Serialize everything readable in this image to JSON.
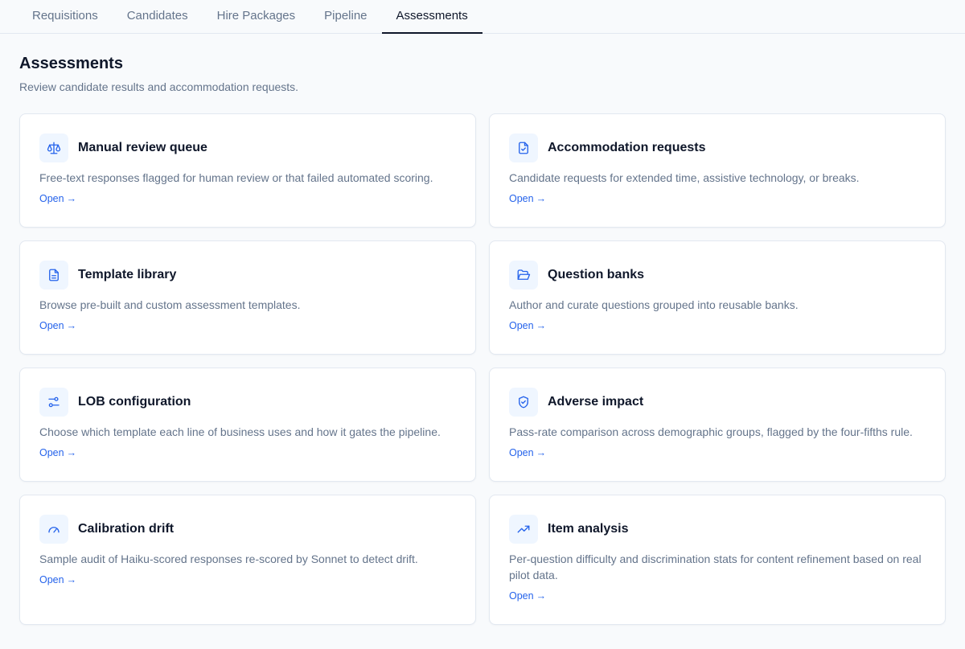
{
  "tabs": [
    {
      "label": "Requisitions"
    },
    {
      "label": "Candidates"
    },
    {
      "label": "Hire Packages"
    },
    {
      "label": "Pipeline"
    },
    {
      "label": "Assessments"
    }
  ],
  "active_tab": "Assessments",
  "page": {
    "title": "Assessments",
    "subtitle": "Review candidate results and accommodation requests."
  },
  "cards": [
    {
      "icon": "scale-icon",
      "title": "Manual review queue",
      "description": "Free-text responses flagged for human review or that failed automated scoring.",
      "link": "Open",
      "arrow": "→"
    },
    {
      "icon": "file-check-icon",
      "title": "Accommodation requests",
      "description": "Candidate requests for extended time, assistive technology, or breaks.",
      "link": "Open",
      "arrow": "→"
    },
    {
      "icon": "document-icon",
      "title": "Template library",
      "description": "Browse pre-built and custom assessment templates.",
      "link": "Open",
      "arrow": "→"
    },
    {
      "icon": "folder-open-icon",
      "title": "Question banks",
      "description": "Author and curate questions grouped into reusable banks.",
      "link": "Open",
      "arrow": "→"
    },
    {
      "icon": "sliders-icon",
      "title": "LOB configuration",
      "description": "Choose which template each line of business uses and how it gates the pipeline.",
      "link": "Open",
      "arrow": "→"
    },
    {
      "icon": "shield-check-icon",
      "title": "Adverse impact",
      "description": "Pass-rate comparison across demographic groups, flagged by the four-fifths rule.",
      "link": "Open",
      "arrow": "→"
    },
    {
      "icon": "gauge-icon",
      "title": "Calibration drift",
      "description": "Sample audit of Haiku-scored responses re-scored by Sonnet to detect drift.",
      "link": "Open",
      "arrow": "→"
    },
    {
      "icon": "trending-up-icon",
      "title": "Item analysis",
      "description": "Per-question difficulty and discrimination stats for content refinement based on real pilot data.",
      "link": "Open",
      "arrow": "→"
    }
  ],
  "colors": {
    "accent": "#2563eb",
    "icon_bg": "#eff6ff",
    "background": "#f8fafc",
    "muted_text": "#64748b",
    "border": "#e2e8f0"
  }
}
